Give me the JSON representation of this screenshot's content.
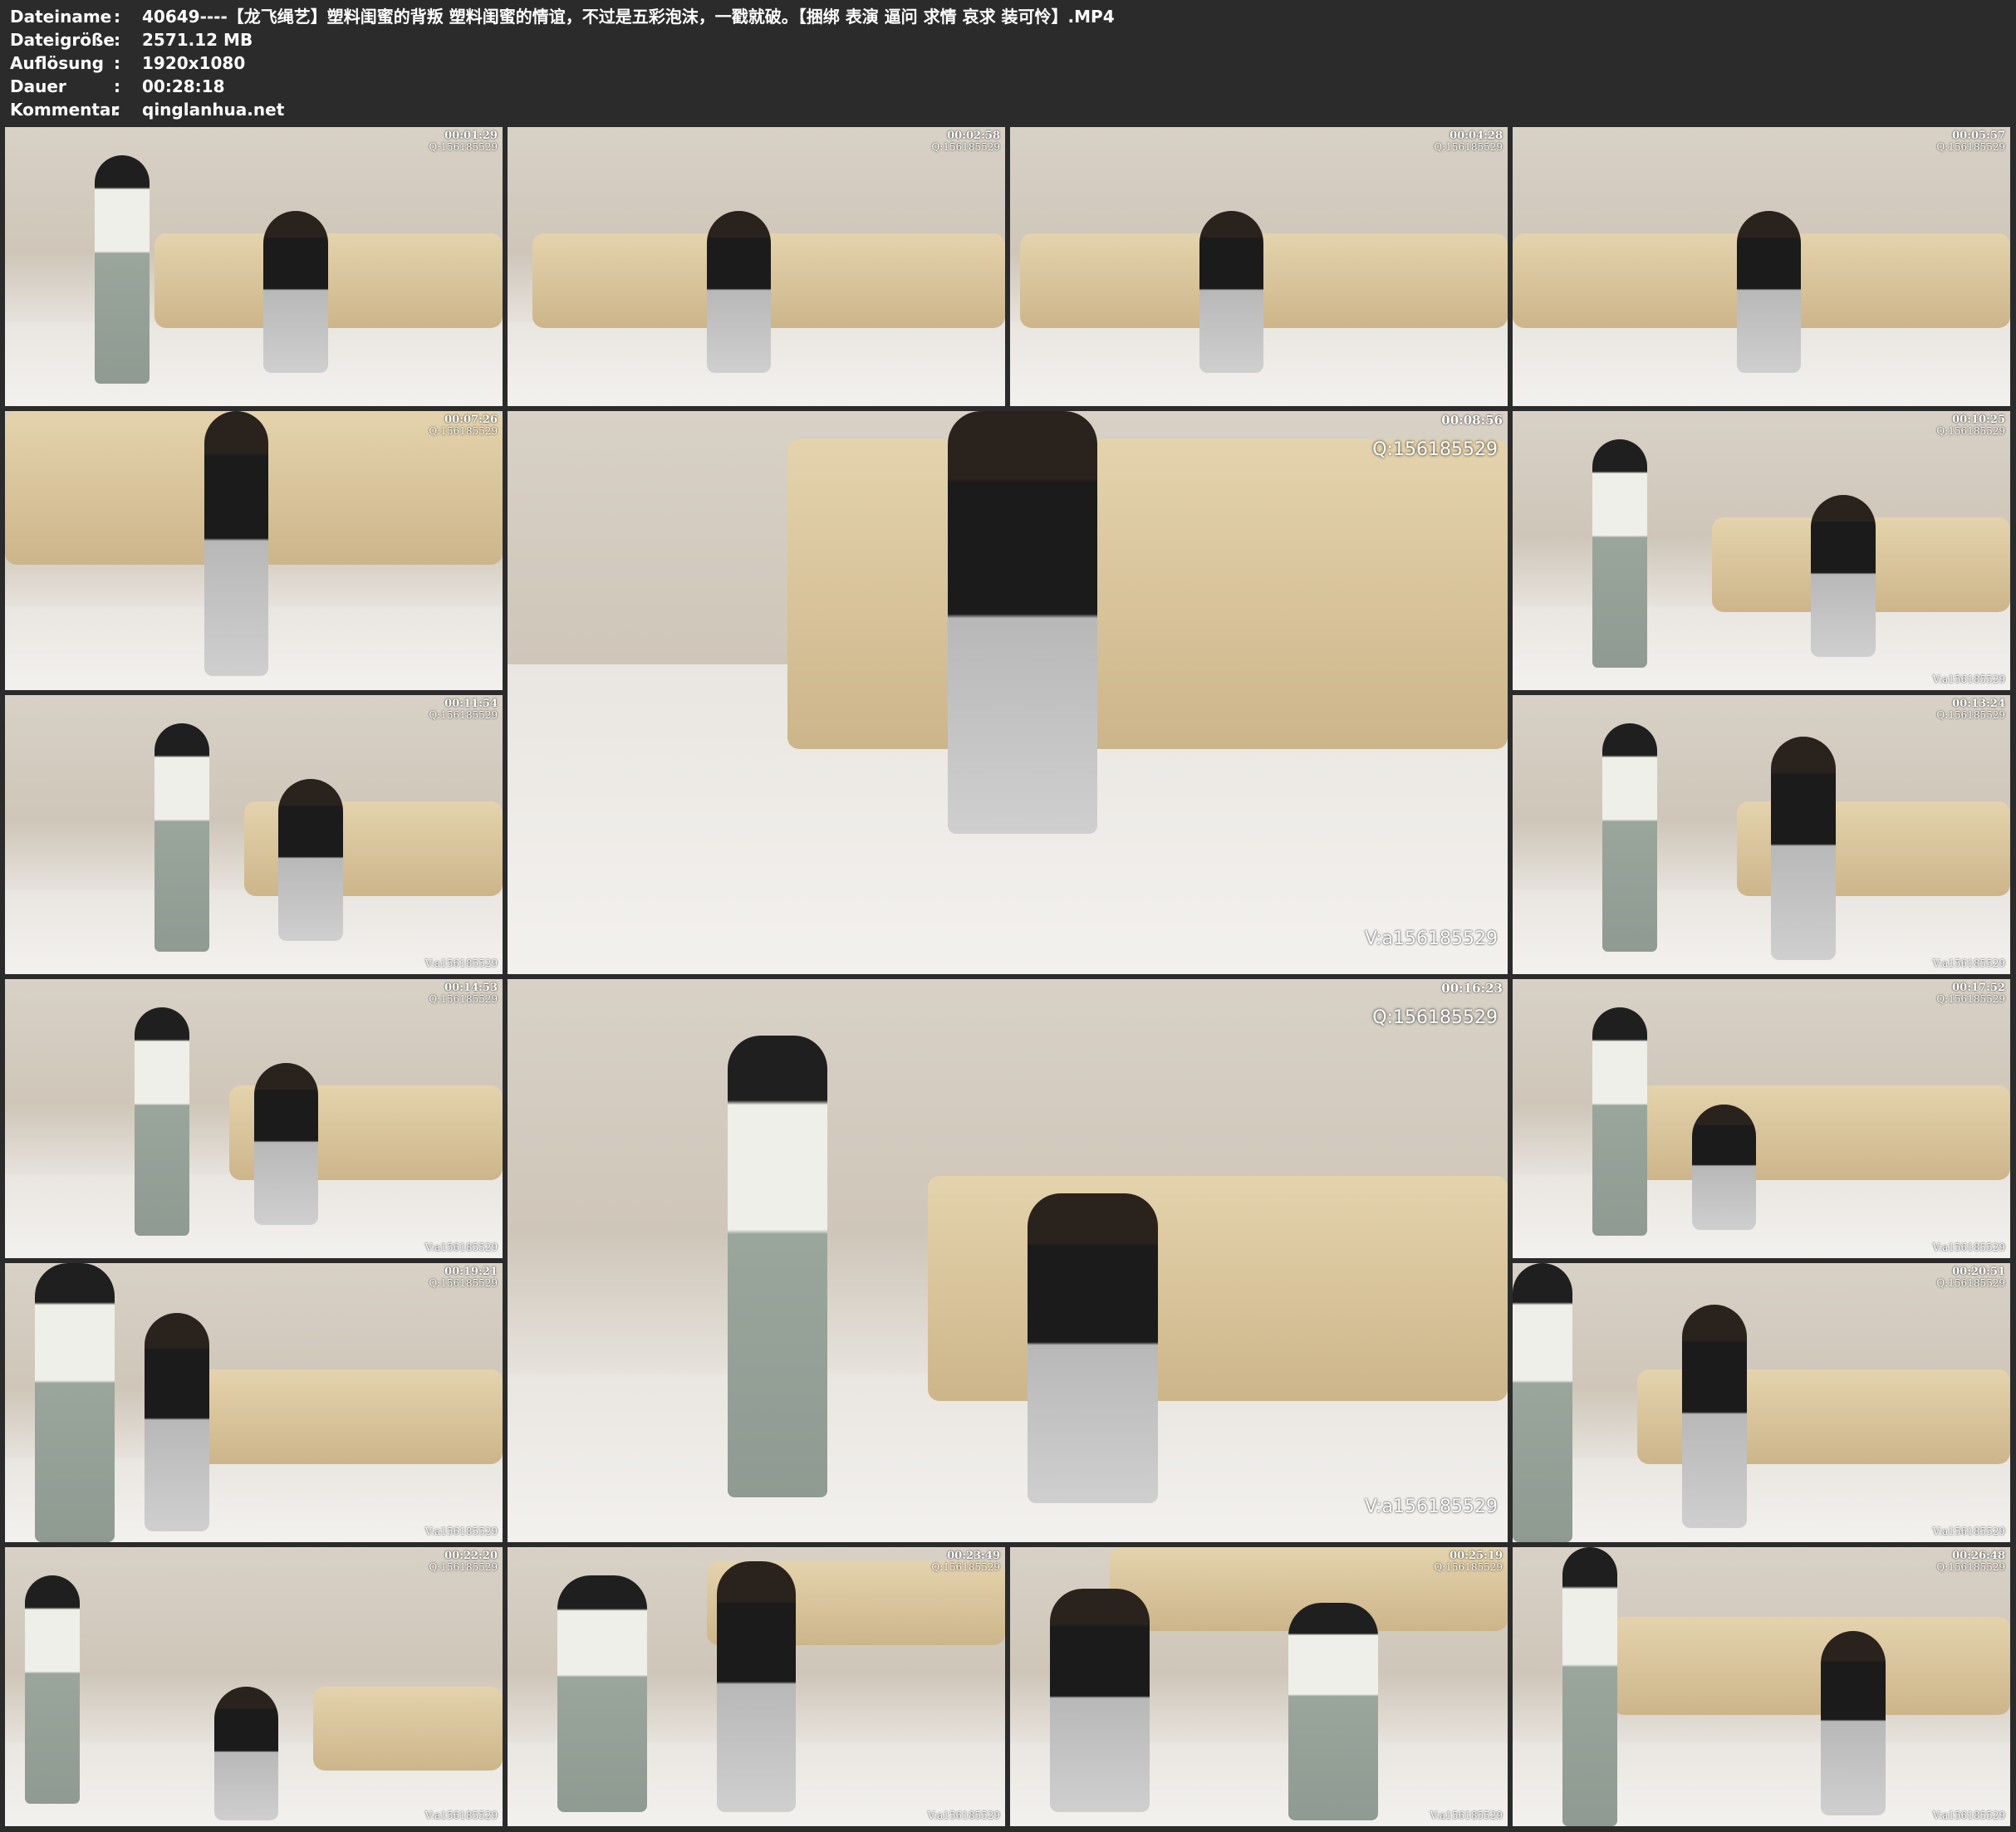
{
  "header": {
    "rows": [
      {
        "label": "Dateiname",
        "value": "40649----【龙飞绳艺】塑料闺蜜的背叛 塑料闺蜜的情谊，不过是五彩泡沫，一戳就破。【捆绑 表演 逼问 求情 哀求 装可怜】.MP4"
      },
      {
        "label": "Dateigröße",
        "value": "2571.12 MB"
      },
      {
        "label": "Auflösung",
        "value": "1920x1080"
      },
      {
        "label": "Dauer",
        "value": "00:28:18"
      },
      {
        "label": "Kommentar",
        "value": "qinglanhua.net"
      }
    ],
    "separator": ":"
  },
  "thumbnails": [
    {
      "time": "00:01:29",
      "q": "Q:156185529",
      "wm": ""
    },
    {
      "time": "00:02:58",
      "q": "Q:156185529",
      "wm": ""
    },
    {
      "time": "00:04:28",
      "q": "Q:156185529",
      "wm": ""
    },
    {
      "time": "00:05:57",
      "q": "Q:156185529",
      "wm": ""
    },
    {
      "time": "00:07:26",
      "q": "Q:156185529",
      "wm": ""
    },
    {
      "time": "00:08:56",
      "q": "Q:156185529",
      "wm": "V:a156185529"
    },
    {
      "time": "00:10:25",
      "q": "Q:156185529",
      "wm": "V:a156185529"
    },
    {
      "time": "00:11:54",
      "q": "Q:156185529",
      "wm": "V:a156185529"
    },
    {
      "time": "00:13:24",
      "q": "Q:156185529",
      "wm": "V:a156185529"
    },
    {
      "time": "00:14:53",
      "q": "Q:156185529",
      "wm": "V:a156185529"
    },
    {
      "time": "00:16:23",
      "q": "Q:156185529",
      "wm": "V:a156185529"
    },
    {
      "time": "00:17:52",
      "q": "Q:156185529",
      "wm": "V:a156185529"
    },
    {
      "time": "00:19:21",
      "q": "Q:156185529",
      "wm": "V:a156185529"
    },
    {
      "time": "00:20:51",
      "q": "Q:156185529",
      "wm": "V:a156185529"
    },
    {
      "time": "00:22:20",
      "q": "Q:156185529",
      "wm": "V:a156185529"
    },
    {
      "time": "00:23:49",
      "q": "Q:156185529",
      "wm": "V:a156185529"
    },
    {
      "time": "00:25:19",
      "q": "Q:156185529",
      "wm": "V:a156185529"
    },
    {
      "time": "00:26:48",
      "q": "Q:156185529",
      "wm": "V:a156185529"
    }
  ]
}
